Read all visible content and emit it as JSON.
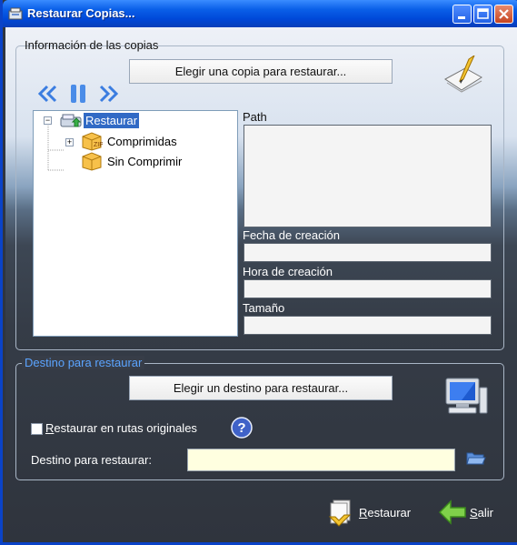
{
  "window": {
    "title": "Restaurar Copias...",
    "icon": "restore-app-icon"
  },
  "copies_group": {
    "legend": "Información de las copias",
    "choose_copy_button": "Elegir una copia para restaurar...",
    "nav": [
      "first-icon",
      "pause-icon",
      "last-icon"
    ],
    "tree": [
      {
        "label": "Restaurar",
        "icon": "drive-restore-icon",
        "selected": true,
        "expanded": true
      },
      {
        "label": "Comprimidas",
        "icon": "box-zip-icon",
        "expandable": true
      },
      {
        "label": "Sin Comprimir",
        "icon": "box-icon",
        "expandable": false
      }
    ],
    "path_label": "Path",
    "path_value": "",
    "fecha_label": "Fecha de creación",
    "fecha_value": "",
    "hora_label": "Hora de creación",
    "hora_value": "",
    "tamano_label": "Tamaño",
    "tamano_value": ""
  },
  "destino_group": {
    "legend": "Destino para restaurar",
    "choose_dest_button": "Elegir un destino para restaurar...",
    "checkbox_prefix": "R",
    "checkbox_rest": "estaurar en rutas originales",
    "checkbox_checked": false,
    "dest_label": "Destino para restaurar:",
    "dest_value": ""
  },
  "footer": {
    "restore_prefix": "R",
    "restore_rest": "estaurar",
    "exit_prefix": "S",
    "exit_rest": "alir"
  },
  "colors": {
    "title_bar": "#0a5fe8",
    "legend_destino": "#5ba4ff",
    "selection": "#316ac5",
    "dest_field": "#ffffe0"
  }
}
